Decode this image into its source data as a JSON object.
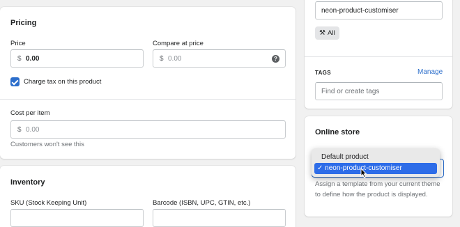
{
  "pricing": {
    "title": "Pricing",
    "price_label": "Price",
    "price_prefix": "$",
    "price_value": "0.00",
    "compare_label": "Compare at price",
    "compare_prefix": "$",
    "compare_placeholder": "0.00",
    "help_glyph": "?",
    "charge_tax_label": "Charge tax on this product",
    "charge_tax_checked": true,
    "cost_label": "Cost per item",
    "cost_prefix": "$",
    "cost_placeholder": "0.00",
    "cost_helper": "Customers won't see this"
  },
  "inventory": {
    "title": "Inventory",
    "sku_label": "SKU (Stock Keeping Unit)",
    "barcode_label": "Barcode (ISBN, UPC, GTIN, etc.)"
  },
  "organization": {
    "template_value": "neon-product-customiser",
    "all_chip_label": "All",
    "tags_heading": "TAGS",
    "manage_link": "Manage",
    "tags_placeholder": "Find or create tags"
  },
  "online_store": {
    "title": "Online store",
    "options": [
      "Default product",
      "neon-product-customiser"
    ],
    "selected_check": "✓",
    "selected_index": 1,
    "helper": "Assign a template from your current theme to define how the product is displayed."
  },
  "colors": {
    "accent": "#2c6ecb",
    "selection": "#2d6ce8",
    "background": "#f1f1f1"
  }
}
